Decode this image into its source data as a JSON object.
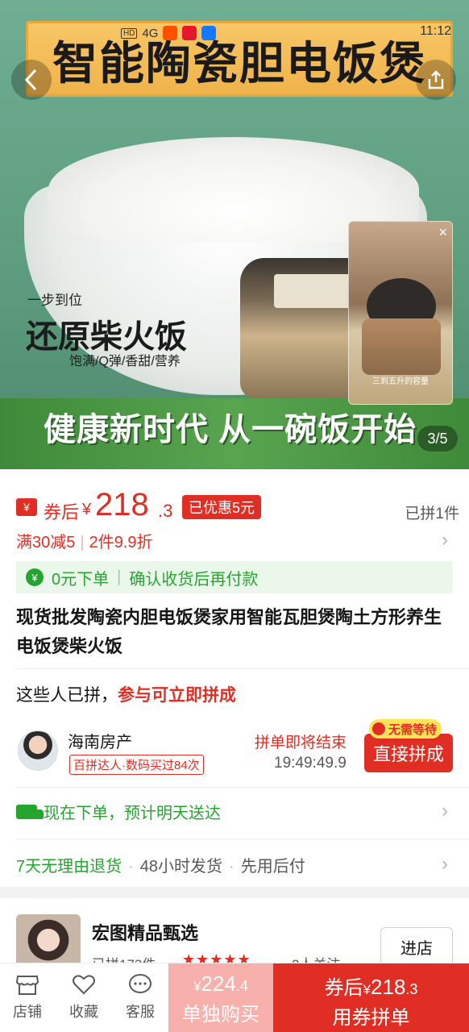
{
  "hero": {
    "banner_title": "智能陶瓷胆电饭煲",
    "status": {
      "hd": "HD",
      "net": "4G",
      "time": "11:12"
    },
    "slogan_small": "一步到位",
    "slogan_large_a": "还原",
    "slogan_large_b": "柴火饭",
    "slogan_tags": "饱满/Q弹/香甜/营养",
    "bottom_slogan": "健康新时代  从一碗饭开始",
    "page_indicator": "3/5",
    "video_caption": "三到五升的容量"
  },
  "price": {
    "coupon_icon": "¥",
    "prefix": "券后",
    "yen": "¥",
    "integer": "218",
    "decimal": ".3",
    "discount_badge": "已优惠5元",
    "group_count": "已拼1件"
  },
  "promo": {
    "item1": "满30减5",
    "item2": "2件9.9折"
  },
  "zero_order": {
    "part1": "0元下单",
    "part2": "确认收货后再付款"
  },
  "title": "现货批发陶瓷内胆电饭煲家用智能瓦胆煲陶土方形养生电饭煲柴火饭",
  "join": {
    "text": "这些人已拼，",
    "accent": "参与可立即拼成"
  },
  "member": {
    "name": "海南房产",
    "tag": "百拼达人·数码买过84次",
    "ending": "拼单即将结束",
    "countdown": "19:49:49.9",
    "no_wait": "无需等待",
    "join_button": "直接拼成"
  },
  "shipping": "现在下单，预计明天送达",
  "services": {
    "s1": "7天无理由退货",
    "s2": "48小时发货",
    "s3": "先用后付"
  },
  "store": {
    "name": "宏图精品甄选",
    "sub_left": "已拼173件",
    "stars": "★★★★★",
    "sub_right": "2人关注",
    "button": "进店"
  },
  "bottom_bar": {
    "nav": [
      {
        "label": "店铺",
        "icon": "store-icon"
      },
      {
        "label": "收藏",
        "icon": "heart-icon"
      },
      {
        "label": "客服",
        "icon": "chat-icon"
      }
    ],
    "single": {
      "yen": "¥",
      "price_int": "224",
      "price_dec": ".4",
      "label": "单独购买"
    },
    "group": {
      "prefix": "券后",
      "yen": "¥",
      "price_int": "218",
      "price_dec": ".3",
      "label": "用券拼单"
    }
  },
  "colors": {
    "accent": "#e02e24",
    "green": "#25a52f"
  }
}
